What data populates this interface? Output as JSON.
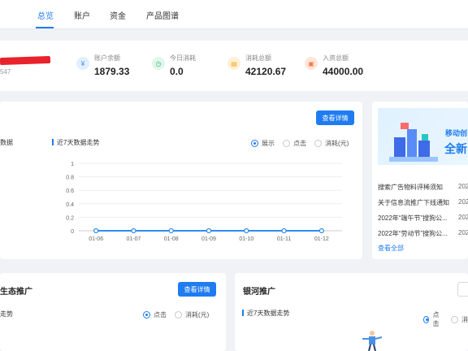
{
  "nav": {
    "tabs": [
      {
        "label": "总览",
        "active": true
      },
      {
        "label": "账户",
        "active": false
      },
      {
        "label": "资金",
        "active": false
      },
      {
        "label": "产品图谱",
        "active": false
      }
    ]
  },
  "summary": {
    "account_id_fragment": "547",
    "metrics": [
      {
        "label": "账户余额",
        "value": "1879.33",
        "icon": "yen-icon",
        "color": "#2f8cf0"
      },
      {
        "label": "今日消耗",
        "value": "0.0",
        "icon": "clock-icon",
        "color": "#2fb96b"
      },
      {
        "label": "消耗总额",
        "value": "42120.67",
        "icon": "list-icon",
        "color": "#f5a623"
      },
      {
        "label": "入资总额",
        "value": "44000.00",
        "icon": "wallet-icon",
        "color": "#f57a45"
      }
    ]
  },
  "overview_card": {
    "detail_button": "查看详情",
    "left_label": "数据",
    "trend_label": "近7天数据走势",
    "radios": [
      {
        "label": "展示",
        "checked": true
      },
      {
        "label": "点击",
        "checked": false
      },
      {
        "label": "消耗(元)",
        "checked": false
      }
    ]
  },
  "chart_data": {
    "type": "line",
    "x": [
      "01-06",
      "01-07",
      "01-08",
      "01-09",
      "01-10",
      "01-11",
      "01-12"
    ],
    "series": [
      {
        "values": [
          0,
          0,
          0,
          0,
          0,
          0,
          0
        ]
      }
    ],
    "yticks": [
      "0",
      "0.2",
      "0.4",
      "0.6",
      "0.8",
      "1"
    ],
    "ylim": [
      0,
      1
    ],
    "grid": true,
    "color": "#2f8cf0"
  },
  "news_panel": {
    "banner_line1": "移动创",
    "banner_line2": "全新",
    "items": [
      {
        "title": "搜索广告物料评稀须知",
        "date": "202"
      },
      {
        "title": "关于信息流推广下线通知",
        "date": "202"
      },
      {
        "title": "2022年“端午节”搜狗公...",
        "date": "202"
      },
      {
        "title": "2022年“劳动节”搜狗公...",
        "date": "202"
      }
    ],
    "view_all": "查看全部"
  },
  "eco_card": {
    "title": "生态推广",
    "detail_button": "查看详情",
    "left_label": "走势",
    "radios": [
      {
        "label": "点击",
        "checked": true
      },
      {
        "label": "消耗(元)",
        "checked": false
      }
    ]
  },
  "galaxy_card": {
    "title": "银河推广",
    "trend_label": "近7天数据走势",
    "radios": [
      {
        "label": "点击",
        "checked": true
      },
      {
        "label": "消",
        "checked": false
      }
    ]
  }
}
